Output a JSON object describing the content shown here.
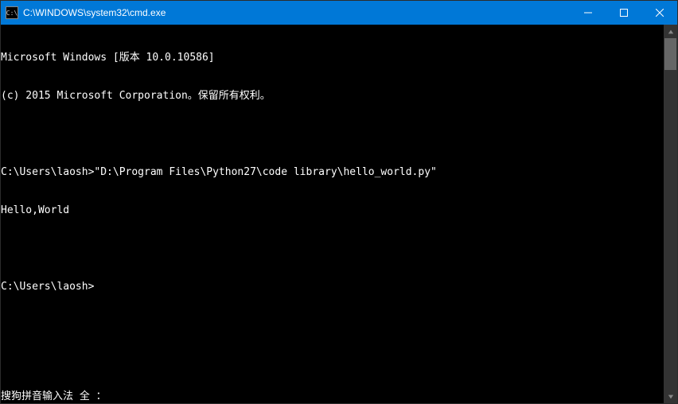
{
  "titlebar": {
    "title": "C:\\WINDOWS\\system32\\cmd.exe",
    "icon_text": "C:\\"
  },
  "console": {
    "lines": [
      "Microsoft Windows [版本 10.0.10586]",
      "(c) 2015 Microsoft Corporation。保留所有权利。",
      "",
      "C:\\Users\\laosh>\"D:\\Program Files\\Python27\\code library\\hello_world.py\"",
      "Hello,World",
      "",
      "C:\\Users\\laosh>"
    ],
    "ime_status": "搜狗拼音输入法 全 ："
  }
}
